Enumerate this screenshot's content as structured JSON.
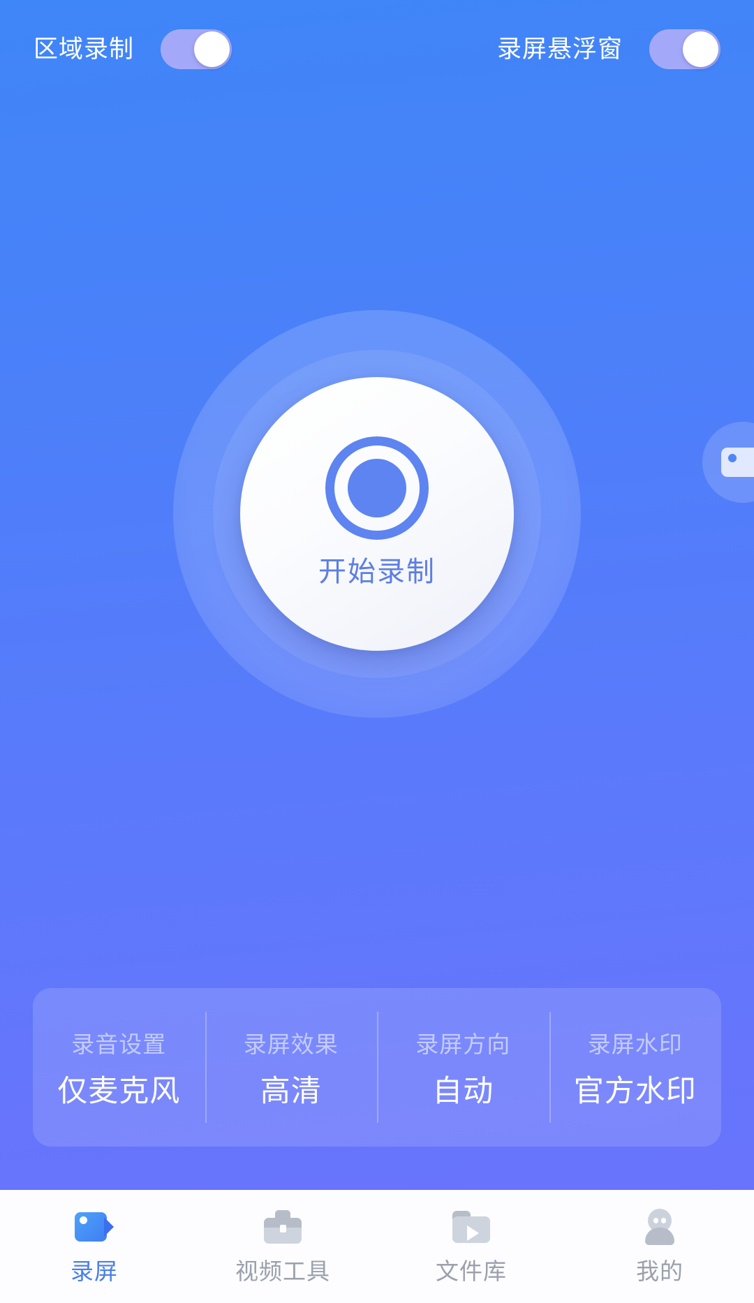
{
  "app": {
    "background_top_color": "#3f86f8",
    "background_bottom_color": "#6a72fb",
    "accent_color": "#5d84f0",
    "nav_active_color": "#4a7fe8"
  },
  "topbar": {
    "region_record": {
      "label": "区域录制",
      "state": "on"
    },
    "floating_window": {
      "label": "录屏悬浮窗",
      "state": "on"
    }
  },
  "record": {
    "button_label": "开始录制",
    "icon": "record-circle-icon"
  },
  "floating_bubble": {
    "icon": "camcorder-icon"
  },
  "settings": {
    "items": [
      {
        "title": "录音设置",
        "value": "仅麦克风"
      },
      {
        "title": "录屏效果",
        "value": "高清"
      },
      {
        "title": "录屏方向",
        "value": "自动"
      },
      {
        "title": "录屏水印",
        "value": "官方水印"
      }
    ]
  },
  "bottom_nav": {
    "items": [
      {
        "label": "录屏",
        "icon": "camcorder-icon",
        "active": true
      },
      {
        "label": "视频工具",
        "icon": "toolbox-icon",
        "active": false
      },
      {
        "label": "文件库",
        "icon": "folder-play-icon",
        "active": false
      },
      {
        "label": "我的",
        "icon": "person-icon",
        "active": false
      }
    ]
  }
}
